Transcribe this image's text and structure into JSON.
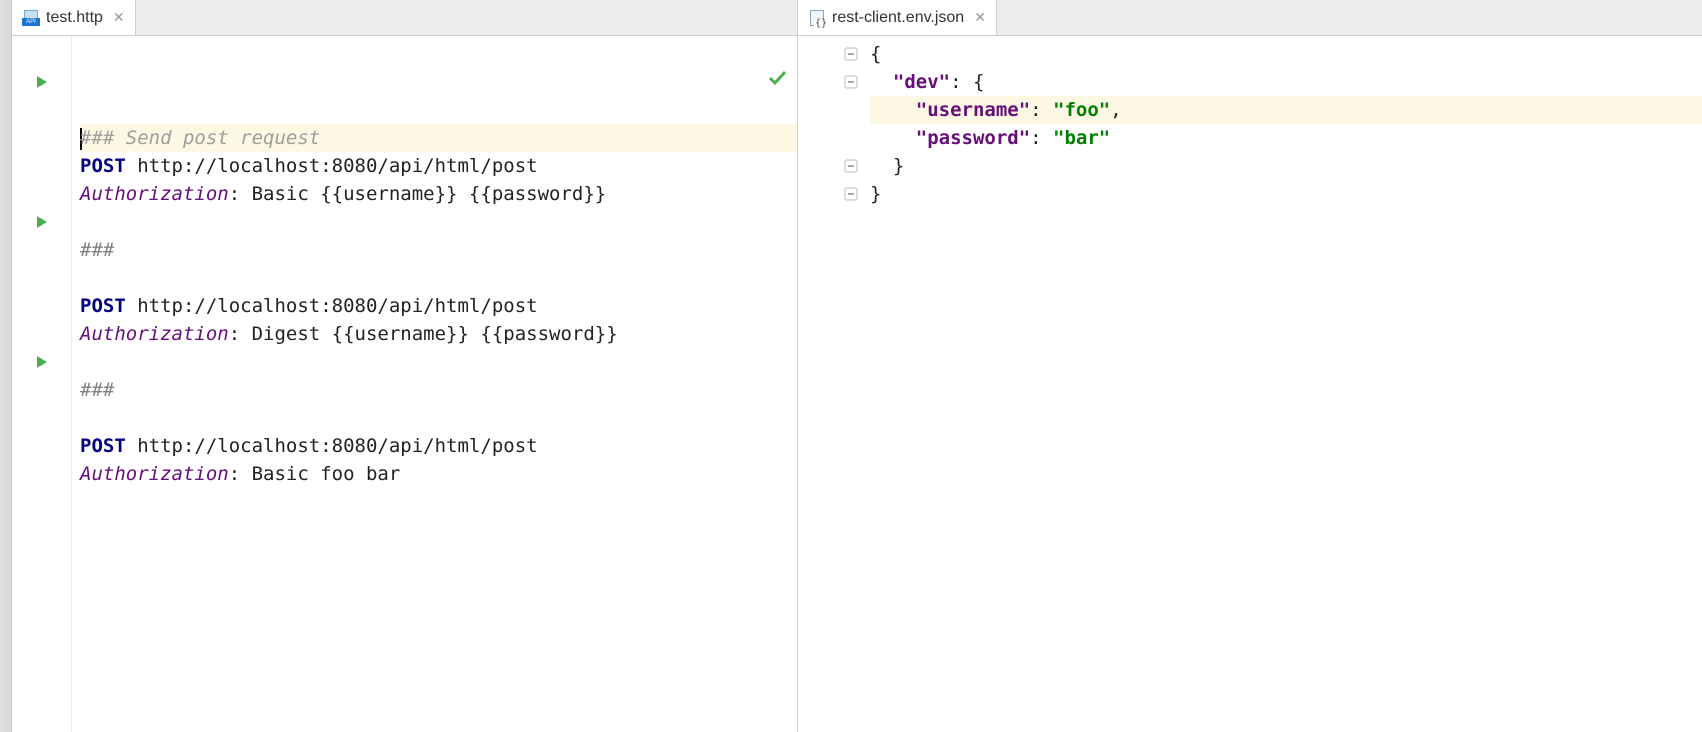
{
  "left": {
    "tab": {
      "label": "test.http"
    },
    "runMarkers": [
      2,
      7,
      12
    ],
    "highlightLine": 1,
    "lines": [
      {
        "t": "comment",
        "text": "### Send post request"
      },
      {
        "t": "req",
        "method": "POST",
        "url": " http://localhost:8080/api/html/post"
      },
      {
        "t": "hdr",
        "name": "Authorization",
        "value": ": Basic {{username}} {{password}}"
      },
      {
        "t": "blank",
        "text": ""
      },
      {
        "t": "sep",
        "text": "###"
      },
      {
        "t": "blank",
        "text": ""
      },
      {
        "t": "req",
        "method": "POST",
        "url": " http://localhost:8080/api/html/post"
      },
      {
        "t": "hdr",
        "name": "Authorization",
        "value": ": Digest {{username}} {{password}}"
      },
      {
        "t": "blank",
        "text": ""
      },
      {
        "t": "sep",
        "text": "###"
      },
      {
        "t": "blank",
        "text": ""
      },
      {
        "t": "req",
        "method": "POST",
        "url": " http://localhost:8080/api/html/post"
      },
      {
        "t": "hdr",
        "name": "Authorization",
        "value": ": Basic foo bar"
      }
    ]
  },
  "right": {
    "tab": {
      "label": "rest-client.env.json"
    },
    "highlightLine": 3,
    "foldMarkers": [
      {
        "line": 1,
        "kind": "open"
      },
      {
        "line": 2,
        "kind": "open"
      },
      {
        "line": 5,
        "kind": "close"
      },
      {
        "line": 6,
        "kind": "close"
      }
    ],
    "lines": [
      {
        "tokens": [
          {
            "c": "json-brace",
            "v": "{"
          }
        ]
      },
      {
        "tokens": [
          {
            "c": "json-brace",
            "v": "  "
          },
          {
            "c": "json-key",
            "v": "\"dev\""
          },
          {
            "c": "json-brace",
            "v": ": {"
          }
        ]
      },
      {
        "tokens": [
          {
            "c": "json-brace",
            "v": "    "
          },
          {
            "c": "json-key",
            "v": "\"username\""
          },
          {
            "c": "json-brace",
            "v": ": "
          },
          {
            "c": "json-str",
            "v": "\"foo\""
          },
          {
            "c": "json-brace",
            "v": ","
          }
        ]
      },
      {
        "tokens": [
          {
            "c": "json-brace",
            "v": "    "
          },
          {
            "c": "json-key",
            "v": "\"password\""
          },
          {
            "c": "json-brace",
            "v": ": "
          },
          {
            "c": "json-str",
            "v": "\"bar\""
          }
        ]
      },
      {
        "tokens": [
          {
            "c": "json-brace",
            "v": "  }"
          }
        ]
      },
      {
        "tokens": [
          {
            "c": "json-brace",
            "v": "}"
          }
        ]
      }
    ]
  }
}
